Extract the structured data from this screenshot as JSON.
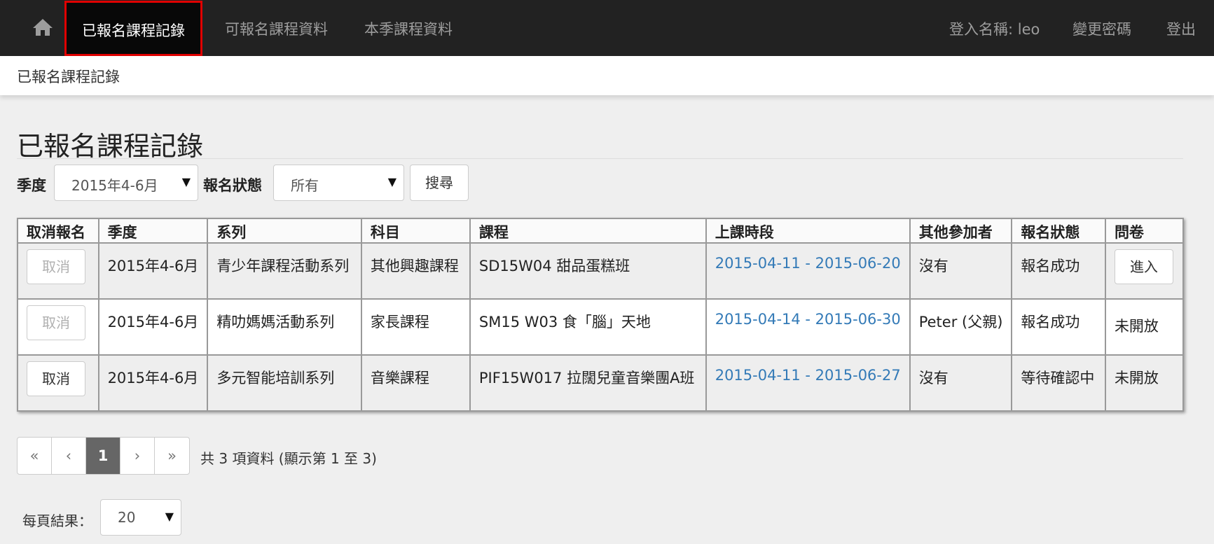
{
  "nav": {
    "items": [
      "已報名課程記錄",
      "可報名課程資料",
      "本季課程資料"
    ],
    "user_label": "登入名稱: leo",
    "change_password": "變更密碼",
    "logout": "登出"
  },
  "breadcrumb": "已報名課程記錄",
  "page_title": "已報名課程記錄",
  "filters": {
    "season_label": "季度",
    "season_value": "2015年4-6月",
    "status_label": "報名狀態",
    "status_value": "所有",
    "search_button": "搜尋"
  },
  "table": {
    "headers": [
      "取消報名",
      "季度",
      "系列",
      "科目",
      "課程",
      "上課時段",
      "其他參加者",
      "報名狀態",
      "問卷"
    ],
    "rows": [
      {
        "cancel": "取消",
        "season": "2015年4-6月",
        "series": "青少年課程活動系列",
        "subject": "其他興趣課程",
        "course": "SD15W04 甜品蛋糕班",
        "period": "2015-04-11 - 2015-06-20",
        "others": "沒有",
        "status": "報名成功",
        "survey": "進入"
      },
      {
        "cancel": "取消",
        "season": "2015年4-6月",
        "series": "精叻媽媽活動系列",
        "subject": "家長課程",
        "course": "SM15 W03 食「腦」天地",
        "period": "2015-04-14 - 2015-06-30",
        "others": "Peter (父親)",
        "status": "報名成功",
        "survey": "未開放"
      },
      {
        "cancel": "取消",
        "season": "2015年4-6月",
        "series": "多元智能培訓系列",
        "subject": "音樂課程",
        "course": "PIF15W017 拉闊兒童音樂團A班",
        "period": "2015-04-11 - 2015-06-27",
        "others": "沒有",
        "status": "等待確認中",
        "survey": "未開放"
      }
    ]
  },
  "pagination": {
    "first": "«",
    "prev": "‹",
    "current": "1",
    "next": "›",
    "last": "»",
    "info": "共 3 項資料 (顯示第 1 至 3)"
  },
  "per_page": {
    "label": "每頁結果：",
    "value": "20"
  },
  "icons": {
    "home": "home-icon",
    "dropdown": "caret-down-icon"
  },
  "colors": {
    "navbar": "#222222",
    "active_outline": "#e00000",
    "link": "#337ab7",
    "pager_active": "#666666"
  }
}
